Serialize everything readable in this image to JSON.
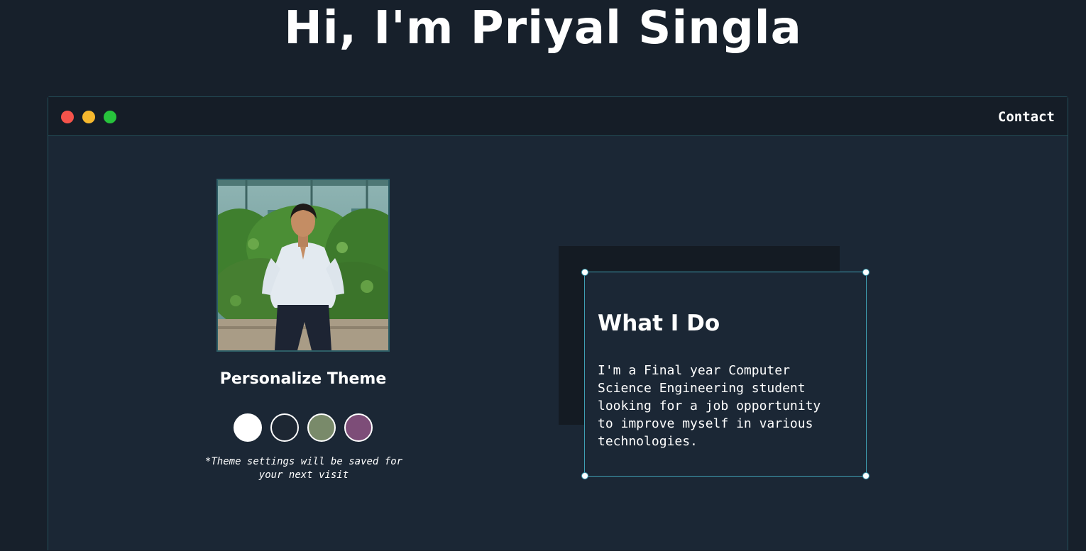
{
  "header": {
    "title": "Hi, I'm Priyal Singla"
  },
  "window": {
    "controls": [
      {
        "name": "close-dot",
        "color": "#f5534b"
      },
      {
        "name": "minimize-dot",
        "color": "#f6b82e"
      },
      {
        "name": "maximize-dot",
        "color": "#27c33c"
      }
    ],
    "nav": {
      "contact_label": "Contact"
    }
  },
  "profile": {
    "photo_icon": "profile-photo"
  },
  "theme": {
    "title": "Personalize Theme",
    "swatches": [
      {
        "name": "white",
        "color": "#ffffff"
      },
      {
        "name": "dark",
        "color": "#1d2733"
      },
      {
        "name": "sage",
        "color": "#798a6a"
      },
      {
        "name": "plum",
        "color": "#7d4d78"
      }
    ],
    "note": "*Theme settings will be saved for\nyour next visit"
  },
  "about": {
    "title": "What I Do",
    "body": "I'm a Final year Computer\nScience Engineering student\nlooking for a job opportunity\nto improve myself in various\ntechnologies."
  },
  "colors": {
    "background": "#17202b",
    "window_bg": "#1b2735",
    "accent": "#3f9fb3"
  }
}
